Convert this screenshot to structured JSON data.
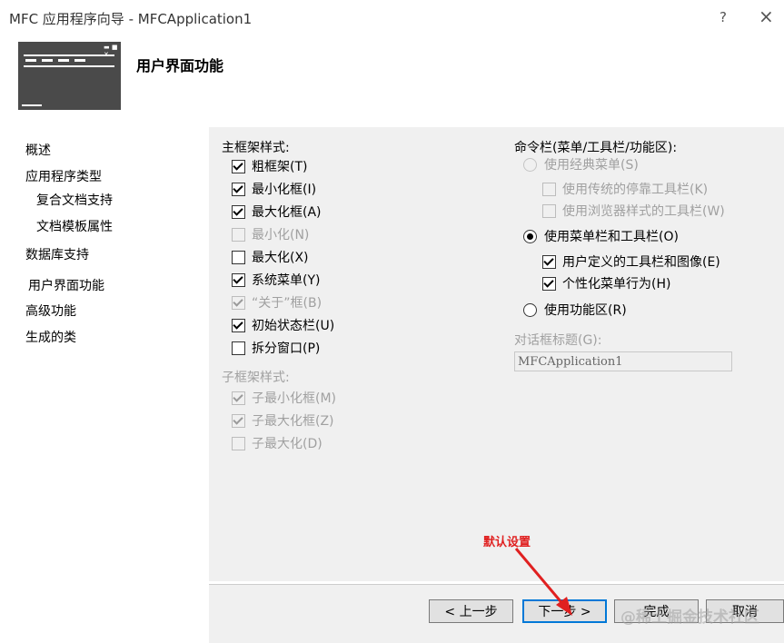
{
  "window": {
    "title": "MFC 应用程序向导 - MFCApplication1",
    "help_label": "?",
    "close_label": "×"
  },
  "header": {
    "page_title": "用户界面功能",
    "banner_icon": "window-frame-icon"
  },
  "sidebar": {
    "items": [
      {
        "label": "概述"
      },
      {
        "label": "应用程序类型"
      },
      {
        "label": "复合文档支持"
      },
      {
        "label": "文档模板属性"
      },
      {
        "label": "数据库支持"
      },
      {
        "label": "用户界面功能",
        "selected": true
      },
      {
        "label": "高级功能"
      },
      {
        "label": "生成的类"
      }
    ]
  },
  "main_frame": {
    "label": "主框架样式:",
    "options": [
      {
        "label": "粗框架(T)",
        "checked": true,
        "enabled": true
      },
      {
        "label": "最小化框(I)",
        "checked": true,
        "enabled": true
      },
      {
        "label": "最大化框(A)",
        "checked": true,
        "enabled": true
      },
      {
        "label": "最小化(N)",
        "checked": false,
        "enabled": false
      },
      {
        "label": "最大化(X)",
        "checked": false,
        "enabled": true
      },
      {
        "label": "系统菜单(Y)",
        "checked": true,
        "enabled": true
      },
      {
        "label": "“关于”框(B)",
        "checked": true,
        "enabled": false
      },
      {
        "label": "初始状态栏(U)",
        "checked": true,
        "enabled": true
      },
      {
        "label": "拆分窗口(P)",
        "checked": false,
        "enabled": true
      }
    ]
  },
  "child_frame": {
    "label": "子框架样式:",
    "options": [
      {
        "label": "子最小化框(M)",
        "checked": true,
        "enabled": false
      },
      {
        "label": "子最大化框(Z)",
        "checked": true,
        "enabled": false
      },
      {
        "label": "子最大化(D)",
        "checked": false,
        "enabled": false
      }
    ]
  },
  "command_bar": {
    "label": "命令栏(菜单/工具栏/功能区):",
    "classic_menu": {
      "label": "使用经典菜单(S)",
      "selected": false,
      "enabled": false
    },
    "classic_sub": [
      {
        "label": "使用传统的停靠工具栏(K)",
        "checked": false,
        "enabled": false
      },
      {
        "label": "使用浏览器样式的工具栏(W)",
        "checked": false,
        "enabled": false
      }
    ],
    "menubar": {
      "label": "使用菜单栏和工具栏(O)",
      "selected": true,
      "enabled": true
    },
    "menubar_sub": [
      {
        "label": "用户定义的工具栏和图像(E)",
        "checked": true,
        "enabled": true
      },
      {
        "label": "个性化菜单行为(H)",
        "checked": true,
        "enabled": true
      }
    ],
    "ribbon": {
      "label": "使用功能区(R)",
      "selected": false,
      "enabled": true
    }
  },
  "dialog_title": {
    "label": "对话框标题(G):",
    "value": "MFCApplication1"
  },
  "annotation": {
    "text": "默认设置",
    "color": "#e02020"
  },
  "watermark": {
    "text": "@稀土掘金技术社区"
  },
  "footer": {
    "prev_label": "< 上一步",
    "next_label": "下一步 >",
    "finish_label": "完成",
    "cancel_label": "取消"
  }
}
